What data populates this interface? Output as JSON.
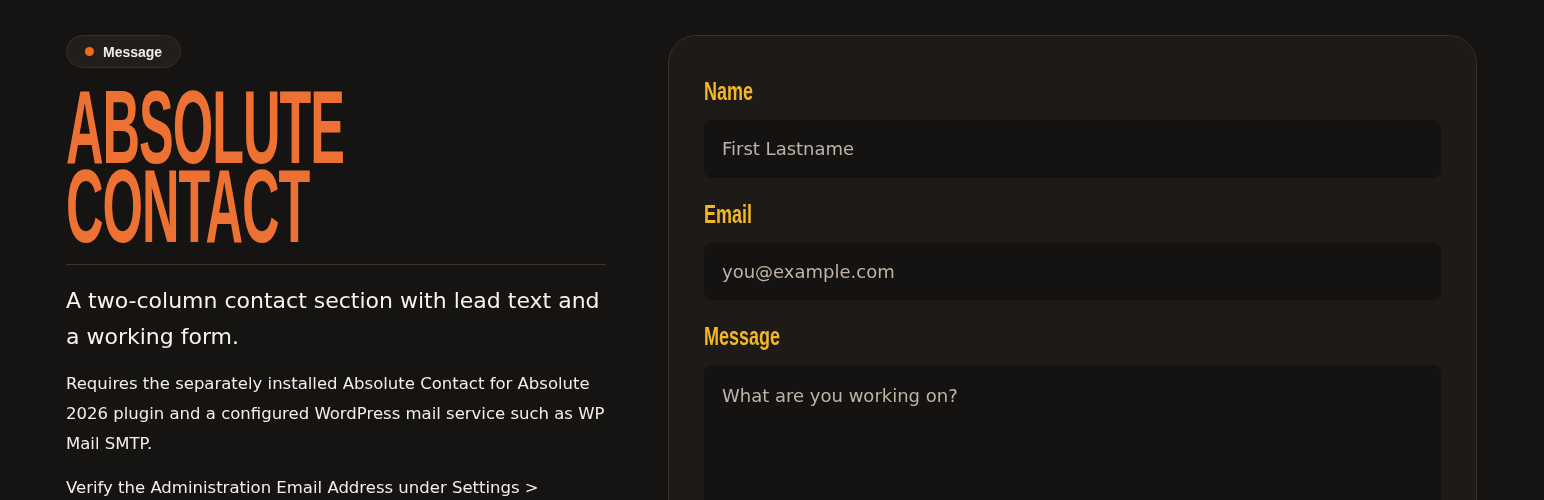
{
  "badge": {
    "label": "Message",
    "color": "#f26b1d"
  },
  "title_lines": [
    "ABSOLUTE",
    "CONTACT"
  ],
  "lead": "A two-column contact section with lead text and a working form.",
  "paragraphs": [
    "Requires the separately installed Absolute Contact for Absolute 2026 plugin and a configured WordPress mail service such as WP Mail SMTP.",
    "Verify the Administration Email Address under Settings >"
  ],
  "form": {
    "fields": [
      {
        "kind": "input",
        "label": "Name",
        "placeholder": "First Lastname"
      },
      {
        "kind": "input",
        "label": "Email",
        "placeholder": "you@example.com"
      },
      {
        "kind": "textarea",
        "label": "Message",
        "placeholder": "What are you working on?"
      }
    ]
  }
}
